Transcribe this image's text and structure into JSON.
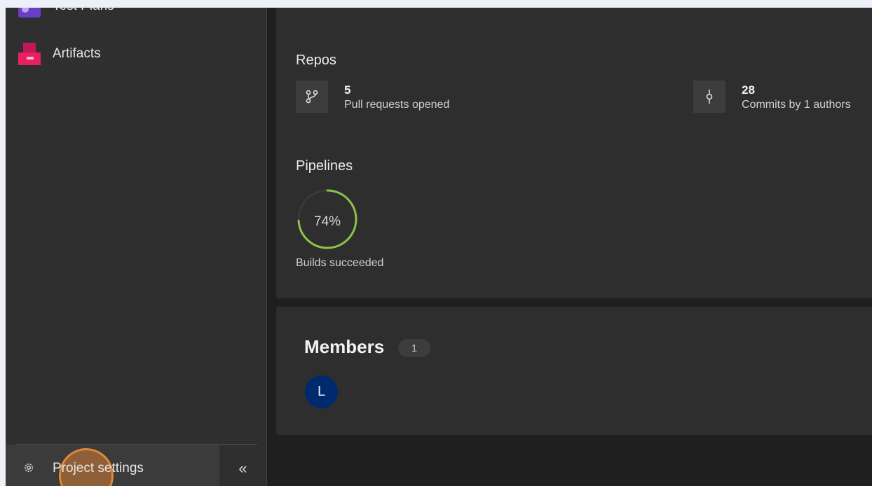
{
  "sidebar": {
    "items": [
      {
        "label": "Test Plans",
        "icon": "test-plans-icon"
      },
      {
        "label": "Artifacts",
        "icon": "artifacts-icon"
      }
    ],
    "footer": {
      "settings_label": "Project settings",
      "collapse_glyph": "«"
    }
  },
  "repos": {
    "title": "Repos",
    "pull_requests": {
      "value": "5",
      "label": "Pull requests opened",
      "icon": "pull-request-icon"
    },
    "commits": {
      "value": "28",
      "label": "Commits by 1 authors",
      "icon": "commit-icon"
    }
  },
  "pipelines": {
    "title": "Pipelines",
    "success_percent": 74,
    "success_text": "74%",
    "label": "Builds succeeded"
  },
  "members": {
    "title": "Members",
    "count": "1",
    "avatars": [
      {
        "initial": "L"
      }
    ]
  },
  "colors": {
    "ring_success": "#8bc34a",
    "avatar": "#002a6e",
    "click_highlight": "#e0883a"
  }
}
